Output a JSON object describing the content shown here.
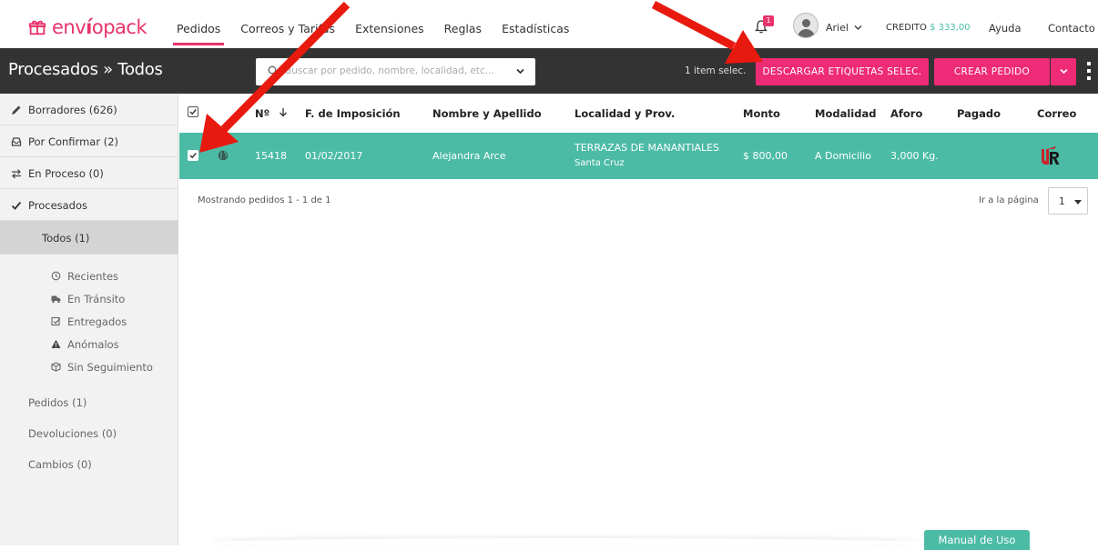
{
  "brand": {
    "logo_part1": "env",
    "logo_part2": "í",
    "logo_part3": "opack"
  },
  "nav": {
    "links": [
      "Pedidos",
      "Correos y Tarifas",
      "Extensiones",
      "Reglas",
      "Estadísticas"
    ],
    "notification_count": "1",
    "user_name": "Ariel",
    "credit_label": "CREDITO",
    "credit_value": "$ 333,00",
    "help": "Ayuda",
    "contact": "Contacto"
  },
  "toolbar": {
    "title": "Procesados » Todos",
    "search_placeholder": "Buscar por pedido, nombre, localidad, etc...",
    "selected_count": "1 item selec.",
    "download_label": "DESCARGAR ETIQUETAS SELEC.",
    "create_label": "CREAR PEDIDO"
  },
  "sidebar": {
    "items": [
      {
        "label": "Borradores (626)",
        "icon": "pencil-icon"
      },
      {
        "label": "Por Confirmar (2)",
        "icon": "inbox-icon"
      },
      {
        "label": "En Proceso (0)",
        "icon": "exchange-icon"
      },
      {
        "label": "Procesados",
        "icon": "check-icon"
      },
      {
        "label": "Todos (1)",
        "icon": ""
      }
    ],
    "subitems": [
      {
        "label": "Recientes",
        "icon": "clock-icon"
      },
      {
        "label": "En Tránsito",
        "icon": "truck-icon"
      },
      {
        "label": "Entregados",
        "icon": "checkbox-icon"
      },
      {
        "label": "Anómalos",
        "icon": "warning-icon"
      },
      {
        "label": "Sin Seguimiento",
        "icon": "box-icon"
      }
    ],
    "others": [
      "Pedidos (1)",
      "Devoluciones (0)",
      "Cambios (0)"
    ]
  },
  "table": {
    "headers": [
      "Nº",
      "F. de Imposición",
      "Nombre y Apellido",
      "Localidad y Prov.",
      "Monto",
      "Modalidad",
      "Aforo",
      "Pagado",
      "Correo"
    ],
    "rows": [
      {
        "checked": true,
        "number": "15418",
        "date": "01/02/2017",
        "name": "Alejandra Arce",
        "locality": "TERRAZAS DE MANANTIALES",
        "province": "Santa Cruz",
        "amount": "$ 800,00",
        "mode": "A Domicilio",
        "weight": "3,000 Kg.",
        "paid": "",
        "carrier": "ŮR"
      }
    ]
  },
  "pagination": {
    "info": "Mostrando pedidos 1 - 1 de 1",
    "goto_label": "Ir a la página",
    "page_value": "1"
  },
  "manual_label": "Manual de Uso",
  "colors": {
    "accent_pink": "#ee2b76",
    "teal": "#4cbba5",
    "dark_bar": "#333333"
  }
}
